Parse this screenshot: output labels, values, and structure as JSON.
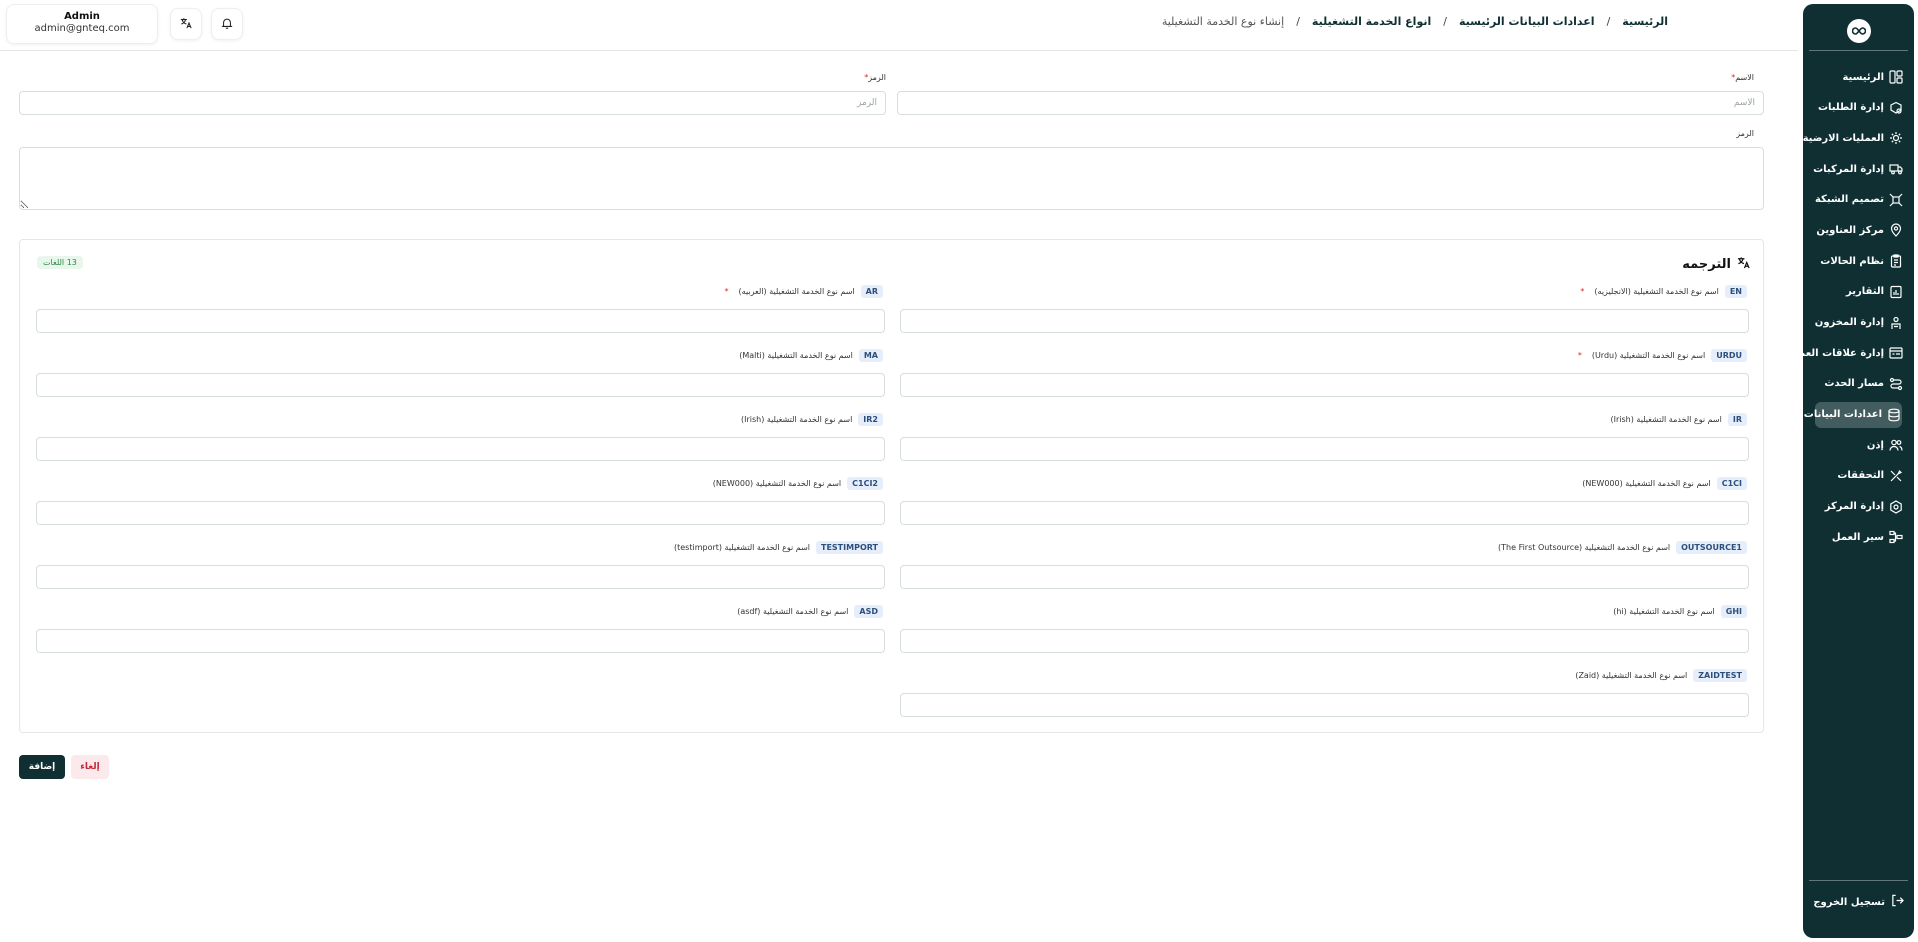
{
  "user": {
    "name": "Admin",
    "email": "admin@gnteq.com"
  },
  "breadcrumb": [
    {
      "label": "الرئيسية"
    },
    {
      "label": "اعدادات البيانات الرئيسية"
    },
    {
      "label": "انواع الخدمة التشغيلية"
    },
    {
      "label": "إنشاء نوع الخدمة التشغيلية"
    }
  ],
  "breadcrumb_sep": "/",
  "sidebar": {
    "items": [
      {
        "label": "الرئيسية",
        "icon": "layout-icon"
      },
      {
        "label": "إدارة الطلبات",
        "icon": "box-search-icon"
      },
      {
        "label": "العمليات الارضية",
        "icon": "sun-gear-icon"
      },
      {
        "label": "إدارة المركبات",
        "icon": "truck-icon"
      },
      {
        "label": "تصميم الشبكة",
        "icon": "network-icon"
      },
      {
        "label": "مركز العناوين",
        "icon": "map-pin-icon"
      },
      {
        "label": "نظام الحالات",
        "icon": "clipboard-icon"
      },
      {
        "label": "التقارير",
        "icon": "report-icon"
      },
      {
        "label": "إدارة المخزون",
        "icon": "warehouse-icon"
      },
      {
        "label": "إدارة علاقات العملاء",
        "icon": "crm-icon"
      },
      {
        "label": "مسار الحدث",
        "icon": "route-icon"
      },
      {
        "label": "اعدادات البيانات",
        "icon": "database-icon",
        "active": true
      },
      {
        "label": "إذن",
        "icon": "users-icon"
      },
      {
        "label": "التحققات",
        "icon": "tools-icon"
      },
      {
        "label": "إدارة المركز",
        "icon": "settings-icon"
      },
      {
        "label": "سير العمل",
        "icon": "workflow-icon"
      }
    ],
    "logout": "تسجيل الخروج"
  },
  "form": {
    "name": {
      "label": "الاسم",
      "placeholder": "الاسم",
      "value": ""
    },
    "code": {
      "label": "الرمز",
      "placeholder": "الرمز",
      "value": ""
    },
    "description": {
      "label": "الرمز",
      "value": ""
    }
  },
  "translation": {
    "title": "الترجمه",
    "languages_badge": "13 اللغات",
    "fields": [
      {
        "code": "EN",
        "label": "اسم نوع الخدمة التشغيلية (الانجليزيه)",
        "required": true,
        "value": ""
      },
      {
        "code": "AR",
        "label": "اسم نوع الخدمة التشغيلية (العربيه)",
        "required": true,
        "value": ""
      },
      {
        "code": "URDU",
        "label": "اسم نوع الخدمة التشغيلية (Urdu)",
        "required": true,
        "value": ""
      },
      {
        "code": "MA",
        "label": "اسم نوع الخدمة التشغيلية (Malti)",
        "required": false,
        "value": ""
      },
      {
        "code": "IR",
        "label": "اسم نوع الخدمة التشغيلية (Irish)",
        "required": false,
        "value": ""
      },
      {
        "code": "IR2",
        "label": "اسم نوع الخدمة التشغيلية (Irish)",
        "required": false,
        "value": ""
      },
      {
        "code": "C1CI",
        "label": "اسم نوع الخدمة التشغيلية (NEW000)",
        "required": false,
        "value": ""
      },
      {
        "code": "C1CI2",
        "label": "اسم نوع الخدمة التشغيلية (NEW000)",
        "required": false,
        "value": ""
      },
      {
        "code": "OUTSOURCE1",
        "label": "اسم نوع الخدمة التشغيلية (The First Outsource)",
        "required": false,
        "value": ""
      },
      {
        "code": "TESTIMPORT",
        "label": "اسم نوع الخدمة التشغيلية (testimport)",
        "required": false,
        "value": ""
      },
      {
        "code": "GHI",
        "label": "اسم نوع الخدمة التشغيلية (hi)",
        "required": false,
        "value": ""
      },
      {
        "code": "ASD",
        "label": "اسم نوع الخدمة التشغيلية (asdf)",
        "required": false,
        "value": ""
      },
      {
        "code": "ZAIDTEST",
        "label": "اسم نوع الخدمة التشغيلية (Zaid)",
        "required": false,
        "value": ""
      }
    ]
  },
  "actions": {
    "add": "إضافة",
    "cancel": "إلغاء"
  },
  "colors": {
    "primary": "#0f2f33",
    "danger": "#c0283c",
    "required": "#d62b2b"
  }
}
